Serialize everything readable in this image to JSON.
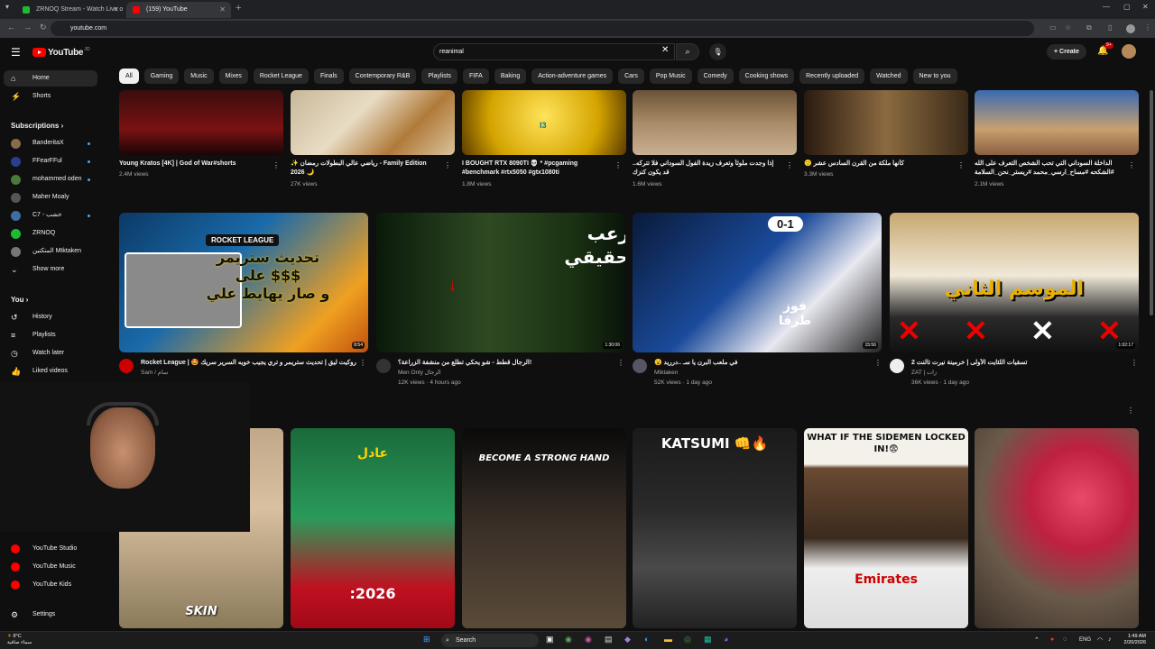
{
  "browser": {
    "tabs": [
      {
        "title": "ZRNOQ Stream - Watch Live o",
        "color": "#1fba33"
      },
      {
        "title": "(159) YouTube",
        "color": "#ff0000"
      }
    ],
    "url": "youtube.com"
  },
  "header": {
    "logo_text": "YouTube",
    "logo_sup": "JO",
    "search_value": "reanimal",
    "create_label": "Create",
    "notif_count": "9+"
  },
  "sidebar": {
    "home": "Home",
    "shorts": "Shorts",
    "subscriptions_title": "Subscriptions",
    "subscriptions": [
      {
        "name": "BanderitaX",
        "color": "#8a6b4a"
      },
      {
        "name": "FFearFFul",
        "color": "#2b3d8f"
      },
      {
        "name": "mohammed oden",
        "color": "#4a7a3a"
      },
      {
        "name": "Maher Moaly",
        "color": "#555"
      },
      {
        "name": "C7 - خشب",
        "color": "#3d6fa5"
      },
      {
        "name": "ZRNOQ",
        "color": "#1fba33"
      },
      {
        "name": "المتكتين Mtktaken",
        "color": "#777"
      }
    ],
    "show_more": "Show more",
    "you_title": "You",
    "you_items": [
      "History",
      "Playlists",
      "Watch later",
      "Liked videos"
    ],
    "more_yt": [
      "YouTube Studio",
      "YouTube Music",
      "YouTube Kids"
    ],
    "settings": "Settings"
  },
  "chips": [
    "All",
    "Gaming",
    "Music",
    "Mixes",
    "Rocket League",
    "Finals",
    "Contemporary R&B",
    "Playlists",
    "FIFA",
    "Baking",
    "Action-adventure games",
    "Cars",
    "Pop Music",
    "Comedy",
    "Cooking shows",
    "Recently uploaded",
    "Watched",
    "New to you"
  ],
  "shorts_row1": [
    {
      "title": "Young Kratos [4K] | God of War#shorts",
      "views": "2.4M views"
    },
    {
      "title": "✨ رياضي عالي البطولات رمضان - Family Edition 2026 🌙",
      "views": "27K views"
    },
    {
      "title": "I BOUGHT RTX 8090TI 💀 * #pcgaming #benchmark #rtx5050 #gtx1080ti",
      "views": "1.8M views"
    },
    {
      "title": "إذا وجدت ملوثاً وتعرف زيدة الفول السوداني فلا تتركه.. قد يكون كنزك",
      "views": "1.6M views"
    },
    {
      "title": "🙂 كأنها ملكة من القرن السادس عشر",
      "views": "3.3M views"
    },
    {
      "title": "الداخلة السوداني التي تحب الشخص التعرف على الله #الشكحه #مساح_ارسي_محمد #ريستر_نحن_السلامة",
      "views": "2.1M views"
    }
  ],
  "videos": [
    {
      "title": "Rocket League | 🤩 روكيت ليق | تحديث ستريمر و تري يجيب خويه السرير سريك 🔥",
      "channel": "Sam / سام",
      "meta": "",
      "duration": "8:54",
      "thumb_text": "تحديث ستريمر\nعلى $$$\nو صار يهايط علي",
      "badge": "ROCKET LEAGUE"
    },
    {
      "title": "الرجال قطط - شو يحكي تطلع من منشفة الزراعة؟!",
      "channel": "Men Only الرجال",
      "meta": "12K views · 4 hours ago",
      "duration": "1:30:06",
      "thumb_text": "رعب\nحقيقي"
    },
    {
      "title": "😮 في ملعب البرن يا سـ ..درريد",
      "channel": "Mtktaken",
      "meta": "52K views · 1 day ago",
      "duration": "15:56",
      "thumb_text": "فوز\nطرقا",
      "score": "0-1"
    },
    {
      "title": "تسقيات اللئايت الأولى | خرمينة نيرت تالنت 2",
      "channel": "ZAT | زات",
      "meta": "36K views · 1 day ago",
      "duration": "1:02:17",
      "thumb_text": "الموسم الثاني"
    }
  ],
  "shorts_row2": [
    {
      "caption": "SKIN"
    },
    {
      "caption": "عادل",
      "caption2": ":2026"
    },
    {
      "caption": "BECOME A STRONG HAND"
    },
    {
      "caption": "KATSUMI 👊🔥"
    },
    {
      "caption": "WHAT IF THE SIDEMEN LOCKED IN!😨",
      "caption2": "Emirates"
    },
    {
      "caption": ""
    }
  ],
  "taskbar": {
    "weather_temp": "8°C",
    "weather_desc": "سماء صافية",
    "search": "Search",
    "lang": "ENG",
    "time": "1:49 AM",
    "date": "2/20/2026"
  }
}
